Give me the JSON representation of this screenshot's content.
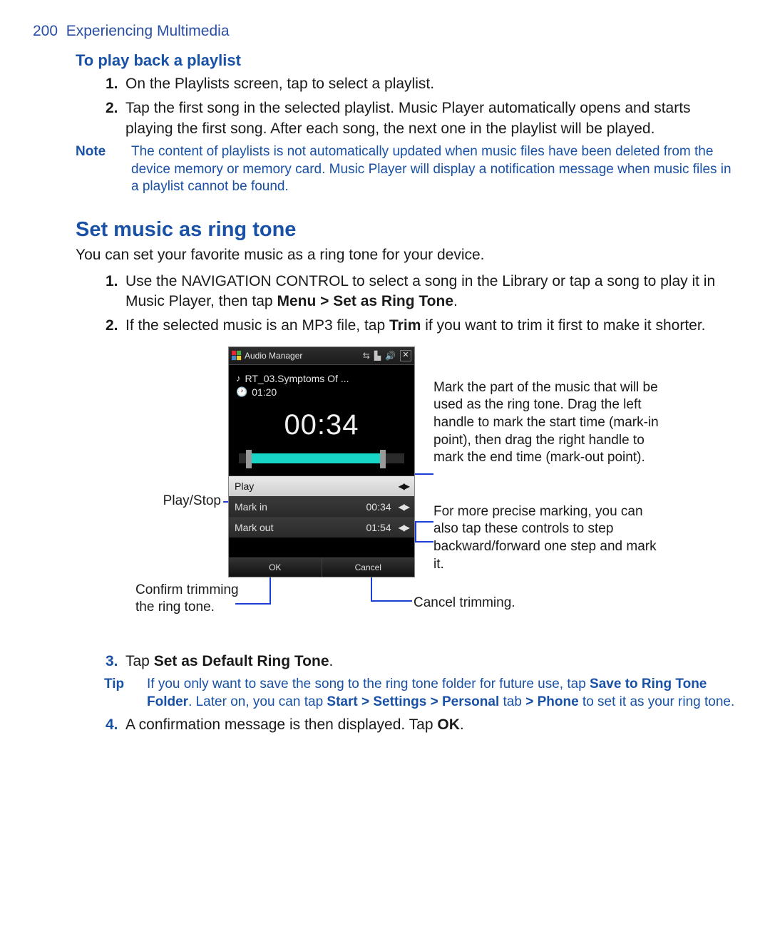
{
  "header": {
    "page_number": "200",
    "chapter_title": "Experiencing Multimedia"
  },
  "section_playback": {
    "heading": "To play back a playlist",
    "items": [
      {
        "num": "1.",
        "text": "On the Playlists screen, tap to select a playlist."
      },
      {
        "num": "2.",
        "text": "Tap the first song in the selected playlist. Music Player automatically opens and starts playing the first song. After each song, the next one in the playlist will be played."
      }
    ],
    "note_label": "Note",
    "note_body": "The content of playlists is not automatically updated when music files have been deleted from the device memory or memory card. Music Player will display a notification message when music files in a playlist cannot be found."
  },
  "section_ringtone": {
    "heading": "Set music as ring tone",
    "intro": "You can set your favorite music as a ring tone for your device.",
    "step1": {
      "num": "1.",
      "pre": "Use the NAVIGATION CONTROL to select a song in the Library or tap a song to play it in Music Player, then tap ",
      "bold": "Menu > Set as Ring Tone",
      "post": "."
    },
    "step2": {
      "num": "2.",
      "pre": "If the selected music is an MP3 file, tap ",
      "bold": "Trim",
      "post": " if you want to trim it first to make it shorter."
    },
    "step3": {
      "num": "3.",
      "pre": "Tap ",
      "bold": "Set as Default Ring Tone",
      "post": "."
    },
    "tip_label": "Tip",
    "tip": {
      "t1": "If you only want to save the song to the ring tone folder for future use, tap ",
      "b1": "Save to Ring Tone Folder",
      "t2": ". Later on, you can tap ",
      "b2": "Start > Settings > Personal",
      "t3": " tab ",
      "b3": "> Phone",
      "t4": " to set it as your ring tone."
    },
    "step4": {
      "num": "4.",
      "pre": "A confirmation message is then displayed. Tap ",
      "bold": "OK",
      "post": "."
    }
  },
  "figure": {
    "titlebar": "Audio Manager",
    "track_title": "RT_03.Symptoms Of ...",
    "track_duration": "01:20",
    "big_time": "00:34",
    "row_play": "Play",
    "row_markin_label": "Mark in",
    "row_markin_value": "00:34",
    "row_markout_label": "Mark out",
    "row_markout_value": "01:54",
    "softkey_ok": "OK",
    "softkey_cancel": "Cancel",
    "callout_playstop": "Play/Stop",
    "callout_confirm": "Confirm trimming the ring tone.",
    "callout_cancel": "Cancel trimming.",
    "callout_mark": "Mark the part of the music that will be used as the ring tone. Drag the left handle to mark the start time (mark-in point), then drag the right handle to mark the end time (mark-out point).",
    "callout_precise": "For more precise marking, you can also tap these controls to step backward/forward one step and mark it."
  }
}
